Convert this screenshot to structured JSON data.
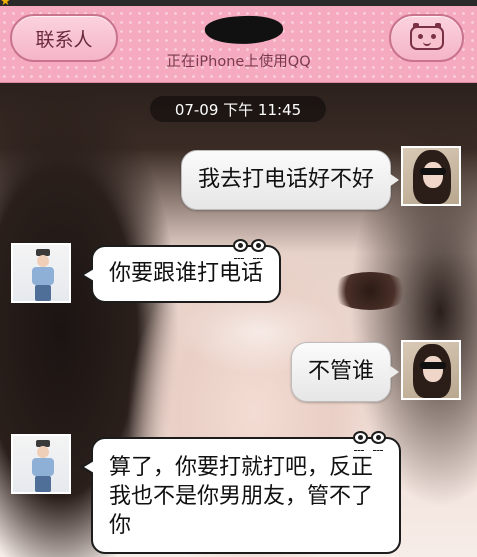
{
  "header": {
    "contacts_button_label": "联系人",
    "status_subtitle": "正在iPhone上使用QQ",
    "profile_icon": "face-icon"
  },
  "chat": {
    "timestamp": "07-09 下午 11:45",
    "messages": [
      {
        "sender": "me",
        "text": "我去打电话好不好"
      },
      {
        "sender": "other",
        "text": "你要跟谁打电话"
      },
      {
        "sender": "me",
        "text": "不管谁"
      },
      {
        "sender": "other",
        "text": "算了，你要打就打吧，反正我也不是你男朋友，管不了你"
      }
    ]
  },
  "colors": {
    "header_pink": "#f5aac0",
    "button_border": "#c9738c"
  }
}
